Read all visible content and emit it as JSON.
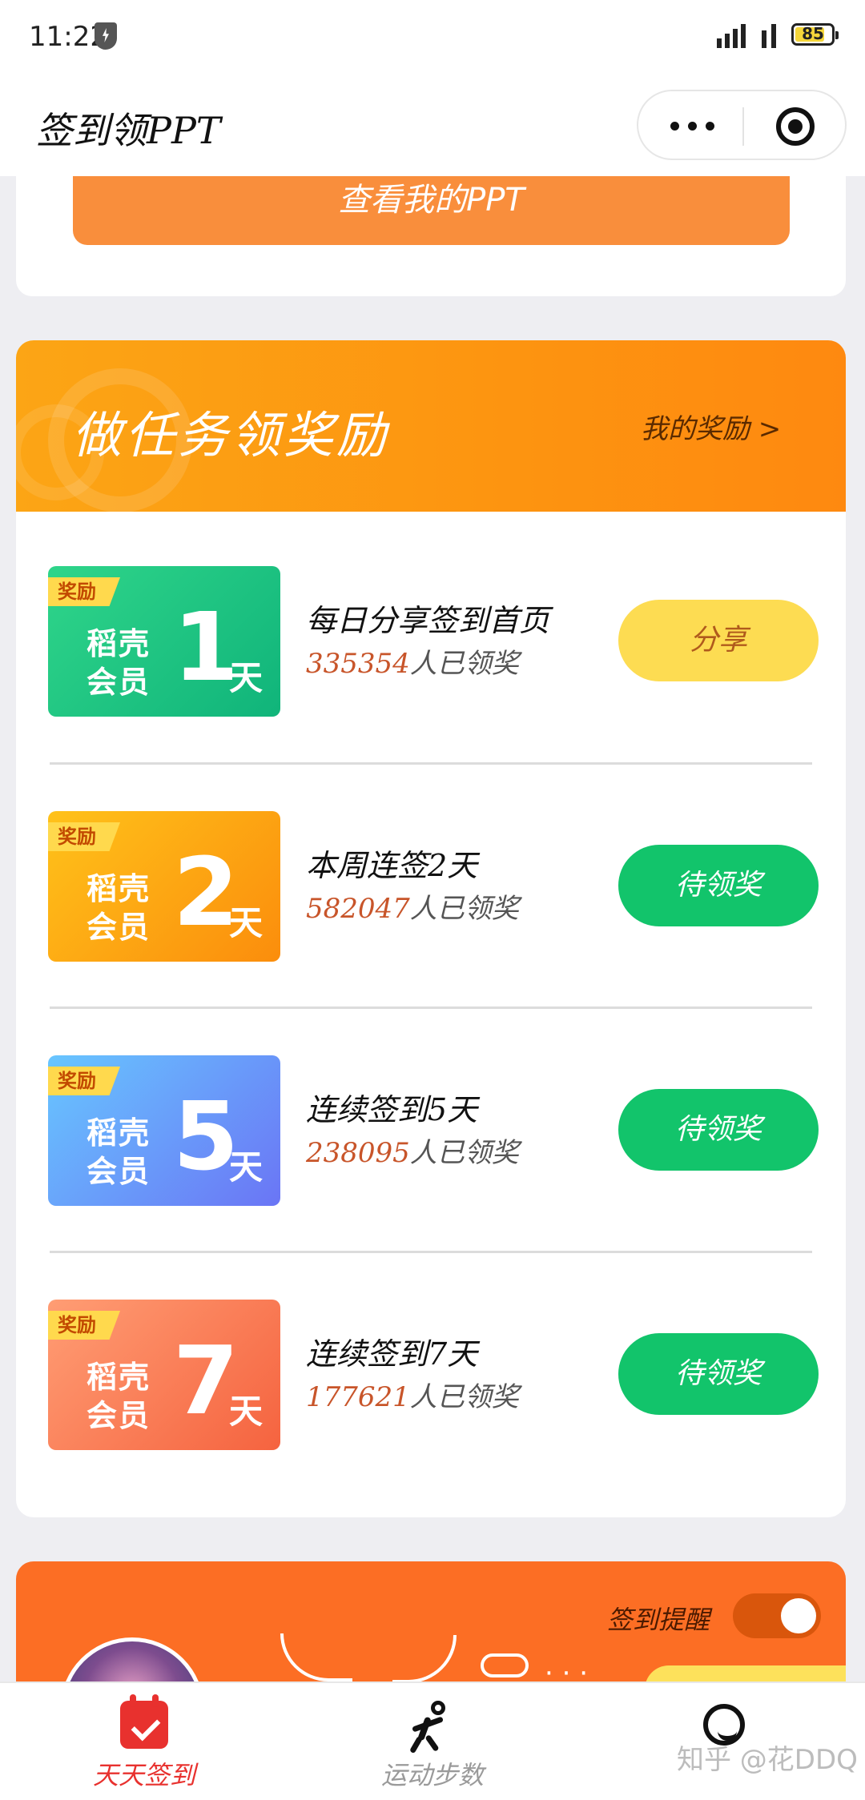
{
  "status_bar": {
    "time": "11:22",
    "battery": "85"
  },
  "nav": {
    "title": "签到领PPT"
  },
  "top_card": {
    "view_button": "查看我的PPT"
  },
  "tasks_section": {
    "title": "做任务领奖励",
    "my_rewards": "我的奖励 >",
    "items": [
      {
        "badge_tag": "奖励",
        "badge_line1": "稻壳",
        "badge_line2": "会员",
        "badge_num": "1",
        "badge_unit": "天",
        "name": "每日分享签到首页",
        "count": "335354",
        "count_suffix": "人已领奖",
        "button": "分享",
        "button_type": "share"
      },
      {
        "badge_tag": "奖励",
        "badge_line1": "稻壳",
        "badge_line2": "会员",
        "badge_num": "2",
        "badge_unit": "天",
        "name": "本周连签2天",
        "count": "582047",
        "count_suffix": "人已领奖",
        "button": "待领奖",
        "button_type": "pending"
      },
      {
        "badge_tag": "奖励",
        "badge_line1": "稻壳",
        "badge_line2": "会员",
        "badge_num": "5",
        "badge_unit": "天",
        "name": "连续签到5天",
        "count": "238095",
        "count_suffix": "人已领奖",
        "button": "待领奖",
        "button_type": "pending"
      },
      {
        "badge_tag": "奖励",
        "badge_line1": "稻壳",
        "badge_line2": "会员",
        "badge_num": "7",
        "badge_unit": "天",
        "name": "连续签到7天",
        "count": "177621",
        "count_suffix": "人已领奖",
        "button": "待领奖",
        "button_type": "pending"
      }
    ],
    "badge_colors": [
      [
        "#2fd58a",
        "#10b47a"
      ],
      [
        "#ffc21a",
        "#fb8d0c"
      ],
      [
        "#68c6ff",
        "#6a75f5"
      ],
      [
        "#ff9d74",
        "#f5633f"
      ]
    ]
  },
  "bottom_card": {
    "remind_label": "签到提醒",
    "remind_on": true
  },
  "tabbar": {
    "tabs": [
      {
        "label": "天天签到",
        "icon": "calendar-check-icon",
        "active": true
      },
      {
        "label": "运动步数",
        "icon": "runner-icon",
        "active": false
      },
      {
        "label": "",
        "icon": "smile-icon",
        "active": false
      }
    ],
    "active_color": "#e8312e",
    "inactive_color": "#999999"
  },
  "watermark": "知乎 @花DDQ"
}
